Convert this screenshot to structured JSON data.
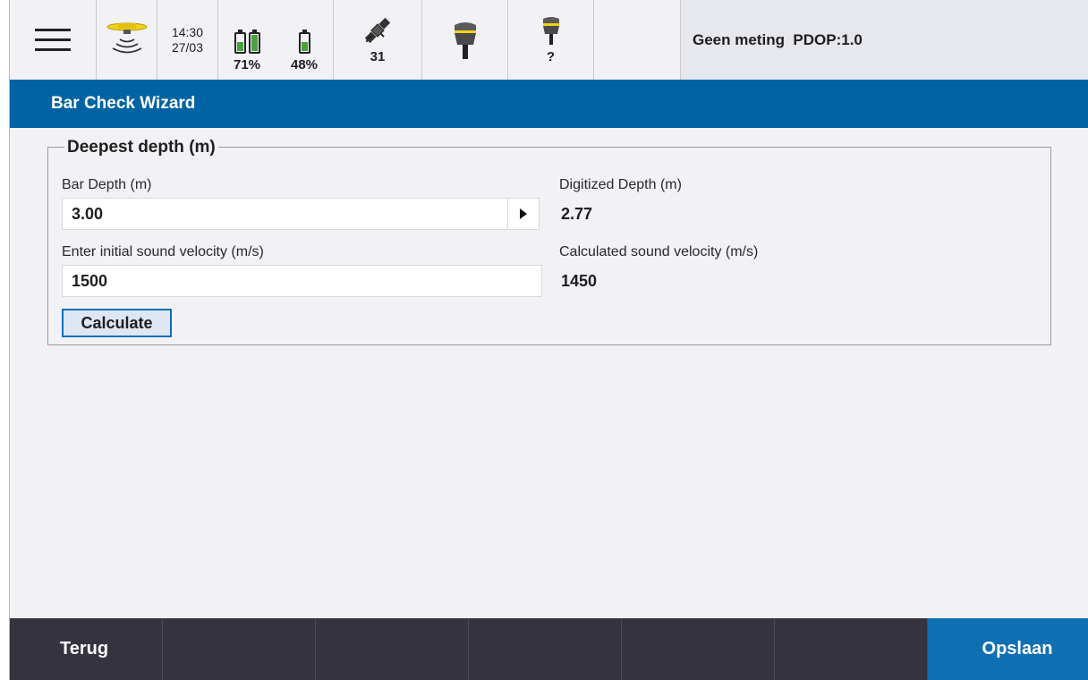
{
  "statusbar": {
    "time": "14:30",
    "date": "27/03",
    "battery1_percent": "71%",
    "battery2_percent": "48%",
    "satellites": "31",
    "receiver2_label": "?",
    "status_text": "Geen meting  PDOP:1.0",
    "icons": {
      "menu": "hamburger-menu-icon",
      "sonar": "sonar-echo-sounder-icon",
      "battery": "battery-icon",
      "satellite": "satellite-icon",
      "receiver": "gnss-receiver-icon"
    }
  },
  "window": {
    "title": "Bar Check Wizard"
  },
  "group": {
    "title": "Deepest depth (m)",
    "bar_depth_label": "Bar Depth (m)",
    "bar_depth_value": "3.00",
    "digitized_depth_label": "Digitized Depth (m)",
    "digitized_depth_value": "2.77",
    "initial_velocity_label": "Enter initial sound velocity (m/s)",
    "initial_velocity_value": "1500",
    "calculated_velocity_label": "Calculated sound velocity (m/s)",
    "calculated_velocity_value": "1450",
    "calculate_label": "Calculate"
  },
  "bottombar": {
    "back_label": "Terug",
    "save_label": "Opslaan"
  },
  "colors": {
    "title_bar": "#0063a3",
    "bottom_bar": "#35333f",
    "save_button": "#0f6fb3",
    "battery_fill": "#48a33a",
    "receiver_accent": "#f1d21b"
  }
}
